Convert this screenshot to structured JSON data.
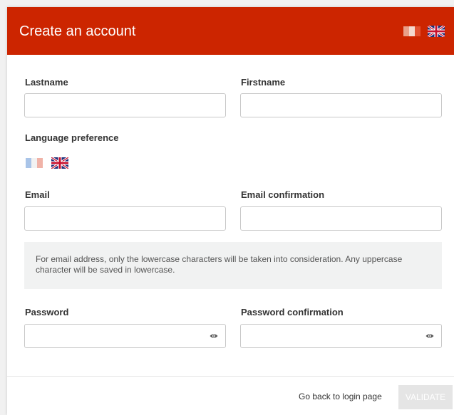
{
  "header": {
    "title": "Create an account",
    "flags": [
      "french-flag-icon",
      "uk-flag-icon"
    ]
  },
  "form": {
    "lastname_label": "Lastname",
    "lastname_value": "",
    "firstname_label": "Firstname",
    "firstname_value": "",
    "language_label": "Language preference",
    "language_options": [
      "french-flag-icon",
      "uk-flag-icon"
    ],
    "email_label": "Email",
    "email_value": "",
    "email_confirm_label": "Email confirmation",
    "email_confirm_value": "",
    "email_notice": "For email address, only the lowercase characters will be taken into consideration. Any uppercase character will be saved in lowercase.",
    "password_label": "Password",
    "password_confirm_label": "Password confirmation"
  },
  "footer": {
    "back_label": "Go back to login page",
    "validate_label": "VALIDATE"
  },
  "colors": {
    "header_bg": "#cc2500",
    "validate_disabled_bg": "#e5e5e5"
  }
}
